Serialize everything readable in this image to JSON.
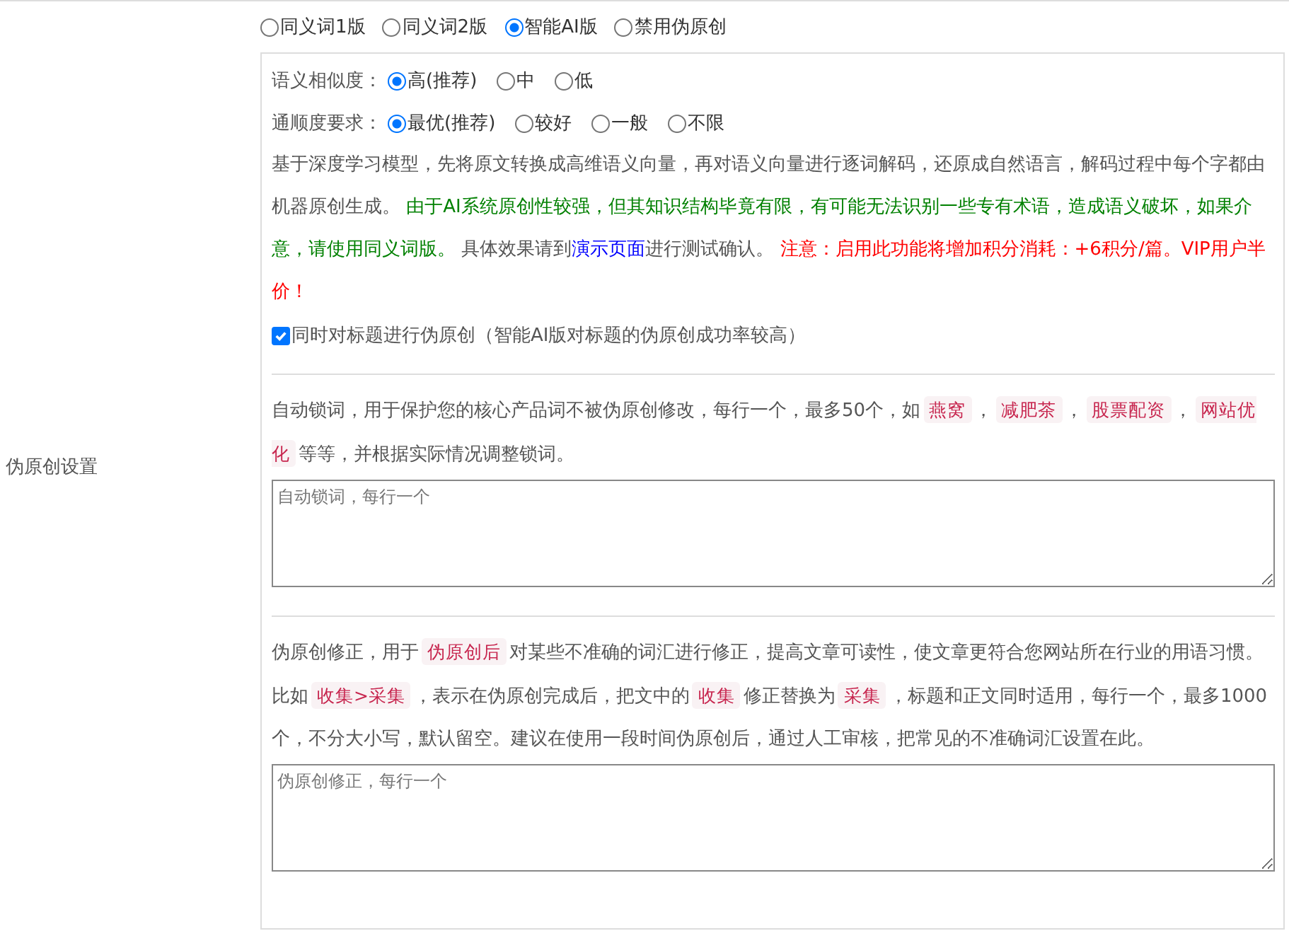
{
  "section_label": "伪原创设置",
  "modes": [
    {
      "label": "同义词1版",
      "selected": false
    },
    {
      "label": "同义词2版",
      "selected": false
    },
    {
      "label": "智能AI版",
      "selected": true
    },
    {
      "label": "禁用伪原创",
      "selected": false
    }
  ],
  "option_groups": [
    {
      "label": "语义相似度：",
      "options": [
        {
          "label": "高(推荐)",
          "selected": true
        },
        {
          "label": "中",
          "selected": false
        },
        {
          "label": "低",
          "selected": false
        }
      ]
    },
    {
      "label": "通顺度要求：",
      "options": [
        {
          "label": "最优(推荐)",
          "selected": true
        },
        {
          "label": "较好",
          "selected": false
        },
        {
          "label": "一般",
          "selected": false
        },
        {
          "label": "不限",
          "selected": false
        }
      ]
    }
  ],
  "ai_description": [
    {
      "kind": "text",
      "text": "基于深度学习模型，先将原文转换成高维语义向量，再对语义向量进行逐词解码，还原成自然语言，解码过程中每个字都由机器原创生成。 "
    },
    {
      "kind": "green",
      "text": "由于AI系统原创性较强，但其知识结构毕竟有限，有可能无法识别一些专有术语，造成语义破坏，如果介意，请使用同义词版。"
    },
    {
      "kind": "text",
      "text": " 具体效果请到"
    },
    {
      "kind": "link",
      "text": "演示页面"
    },
    {
      "kind": "text",
      "text": "进行测试确认。 "
    },
    {
      "kind": "red",
      "text": "注意：启用此功能将增加积分消耗：+6积分/篇。VIP用户半价！"
    }
  ],
  "title_option": {
    "label": "同时对标题进行伪原创（智能AI版对标题的伪原创成功率较高）",
    "checked": true
  },
  "lock_words": {
    "description": [
      {
        "kind": "text",
        "text": "自动锁词，用于保护您的核心产品词不被伪原创修改，每行一个，最多50个，如"
      },
      {
        "kind": "tag",
        "text": "燕窝"
      },
      {
        "kind": "text",
        "text": "，"
      },
      {
        "kind": "tag",
        "text": "减肥茶"
      },
      {
        "kind": "text",
        "text": "，"
      },
      {
        "kind": "tag",
        "text": "股票配资"
      },
      {
        "kind": "text",
        "text": "，"
      },
      {
        "kind": "tag",
        "text": "网站优化"
      },
      {
        "kind": "text",
        "text": "等等，并根据实际情况调整锁词。"
      }
    ],
    "placeholder": "自动锁词，每行一个"
  },
  "corrections": {
    "description": [
      {
        "kind": "text",
        "text": "伪原创修正，用于"
      },
      {
        "kind": "tag",
        "text": "伪原创后"
      },
      {
        "kind": "text",
        "text": "对某些不准确的词汇进行修正，提高文章可读性，使文章更符合您网站所在行业的用语习惯。比如"
      },
      {
        "kind": "tag",
        "text": "收集>采集"
      },
      {
        "kind": "text",
        "text": "，表示在伪原创完成后，把文中的"
      },
      {
        "kind": "tag",
        "text": "收集"
      },
      {
        "kind": "text",
        "text": "修正替换为"
      },
      {
        "kind": "tag",
        "text": "采集"
      },
      {
        "kind": "text",
        "text": "，标题和正文同时适用，每行一个，最多1000个，不分大小写，默认留空。建议在使用一段时间伪原创后，通过人工审核，把常见的不准确词汇设置在此。"
      }
    ],
    "placeholder": "伪原创修正，每行一个"
  }
}
